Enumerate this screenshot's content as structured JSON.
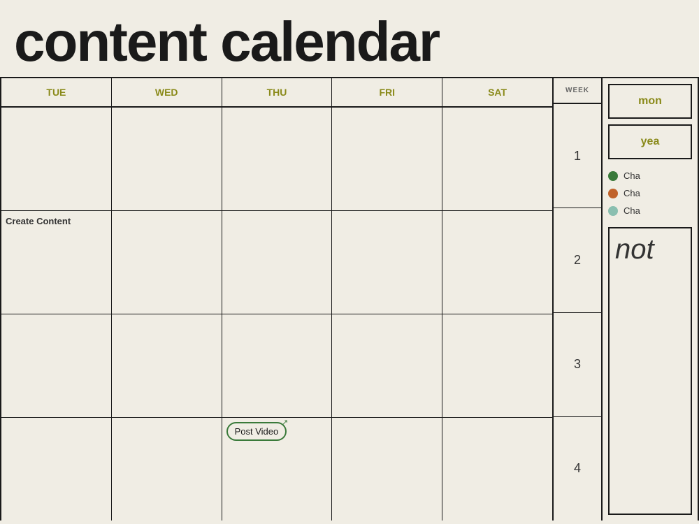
{
  "page": {
    "title": "content calendar",
    "background_color": "#f0ede4"
  },
  "calendar": {
    "day_headers": [
      "TUE",
      "WED",
      "THU",
      "FRI",
      "SAT"
    ],
    "week_header": "WEEK",
    "week_numbers": [
      1,
      2,
      3,
      4
    ],
    "rows": [
      {
        "week": 1,
        "cells": [
          "",
          "",
          "",
          "",
          ""
        ]
      },
      {
        "week": 2,
        "cells": [
          "Create\nContent",
          "",
          "",
          "",
          ""
        ]
      },
      {
        "week": 3,
        "cells": [
          "",
          "",
          "",
          "",
          ""
        ]
      },
      {
        "week": 4,
        "cells": [
          "",
          "",
          "Post Video",
          "",
          ""
        ]
      }
    ]
  },
  "sidebar": {
    "month_btn": "mon",
    "year_btn": "yea",
    "legend": [
      {
        "color": "green",
        "label": "Cha"
      },
      {
        "color": "orange",
        "label": "Cha"
      },
      {
        "color": "lightgreen",
        "label": "Cha"
      }
    ],
    "notes_label": "not"
  }
}
